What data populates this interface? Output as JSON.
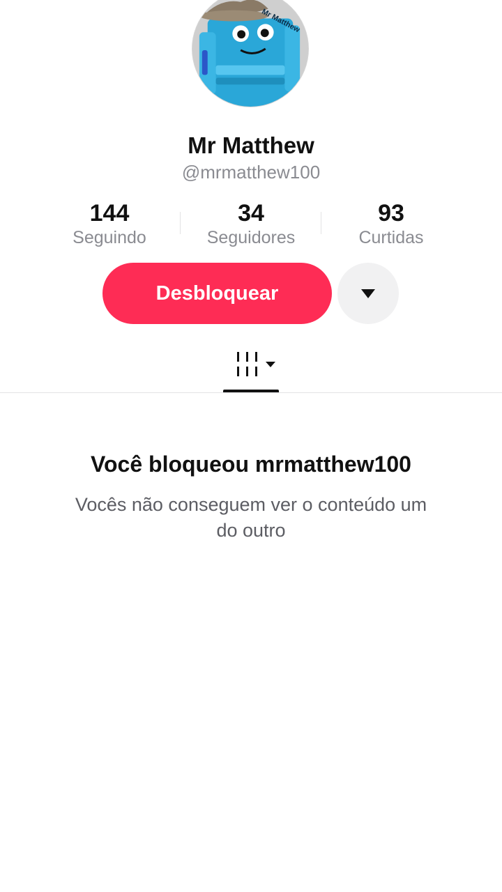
{
  "profile": {
    "avatar_caption": "Mr Matthew",
    "display_name": "Mr Matthew",
    "username": "@mrmatthew100"
  },
  "stats": [
    {
      "value": "144",
      "label": "Seguindo"
    },
    {
      "value": "34",
      "label": "Seguidores"
    },
    {
      "value": "93",
      "label": "Curtidas"
    }
  ],
  "actions": {
    "unblock_label": "Desbloquear",
    "more_icon": "caret-down-icon"
  },
  "tabs": {
    "videos_icon": "grid-columns-icon",
    "selected": "videos"
  },
  "blocked": {
    "title": "Você bloqueou mrmatthew100",
    "description": "Vocês não conseguem ver o conteúdo um do outro"
  },
  "colors": {
    "accent": "#fe2c55",
    "secondary_text": "#8a8b91",
    "button_bg": "#f1f1f2"
  }
}
